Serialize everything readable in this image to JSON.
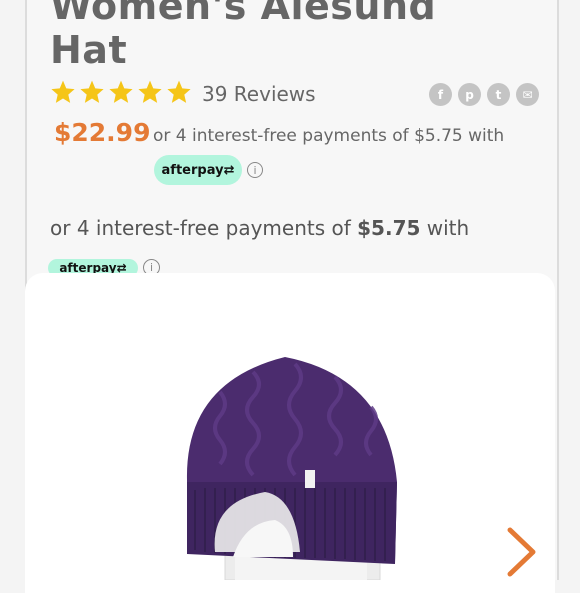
{
  "product": {
    "title_line1": "Women's Alesund",
    "title_line2": "Hat",
    "rating": 5,
    "reviews_label": "39 Reviews",
    "price": "$22.99",
    "installment_text": "or 4 interest-free payments of $5.75 with",
    "afterpay_label": "afterpay",
    "installment2_prefix": "or 4 interest-free payments of ",
    "installment2_amount": "$5.75",
    "installment2_suffix": " with",
    "info_glyph": "i"
  },
  "share": [
    {
      "icon": "facebook-icon",
      "glyph": "f"
    },
    {
      "icon": "pinterest-icon",
      "glyph": "p"
    },
    {
      "icon": "twitter-icon",
      "glyph": "t"
    },
    {
      "icon": "email-icon",
      "glyph": "✉"
    }
  ],
  "colors": {
    "price": "#e47a35",
    "star": "#f5c518",
    "afterpay": "#b2f5dd",
    "hat": "#4b2c6e"
  }
}
